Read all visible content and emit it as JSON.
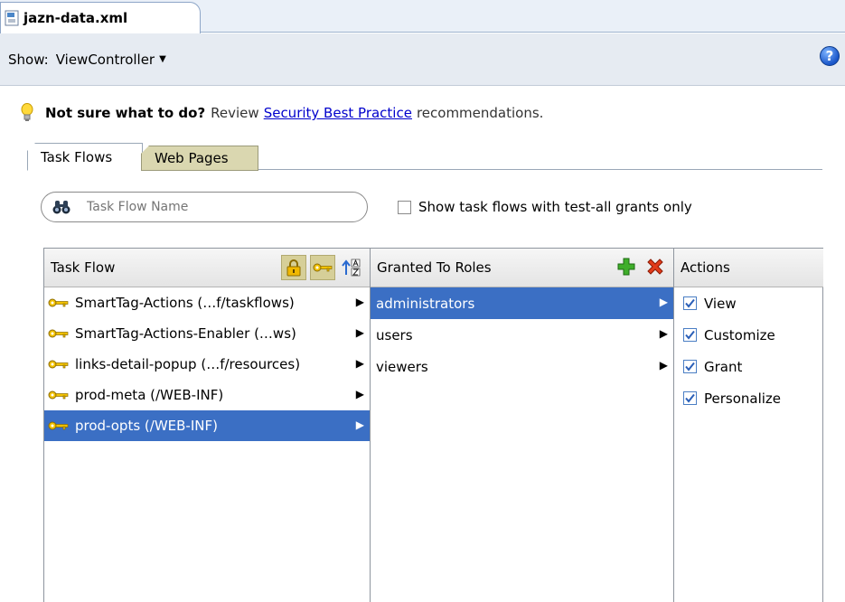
{
  "editor_tab": {
    "file_name": "jazn-data.xml"
  },
  "toolbar": {
    "show_label": "Show:",
    "show_value": "ViewController",
    "help": "?"
  },
  "hint": {
    "bold": "Not sure what to do?",
    "pre": "Review",
    "link": "Security Best Practice",
    "post": "recommendations."
  },
  "tabs": [
    {
      "label": "Task Flows"
    },
    {
      "label": "Web Pages"
    }
  ],
  "search": {
    "placeholder": "Task Flow Name",
    "value": ""
  },
  "filter_checkbox": {
    "label": "Show task flows with test-all grants only",
    "checked": false
  },
  "columns": {
    "task_flow": "Task Flow",
    "granted_roles": "Granted To Roles",
    "actions": "Actions"
  },
  "task_flows": [
    {
      "label": "SmartTag-Actions (…f/taskflows)"
    },
    {
      "label": "SmartTag-Actions-Enabler (…ws)"
    },
    {
      "label": "links-detail-popup (…f/resources)"
    },
    {
      "label": "prod-meta (/WEB-INF)"
    },
    {
      "label": "prod-opts (/WEB-INF)"
    }
  ],
  "selected_task_flow_index": 4,
  "roles": [
    {
      "label": "administrators"
    },
    {
      "label": "users"
    },
    {
      "label": "viewers"
    }
  ],
  "selected_role_index": 0,
  "actions": [
    {
      "label": "View",
      "checked": true
    },
    {
      "label": "Customize",
      "checked": true
    },
    {
      "label": "Grant",
      "checked": true
    },
    {
      "label": "Personalize",
      "checked": true
    }
  ],
  "colors": {
    "selection": "#3b6fc4",
    "link": "#0000cc",
    "accent_tab": "#dad7b0"
  }
}
